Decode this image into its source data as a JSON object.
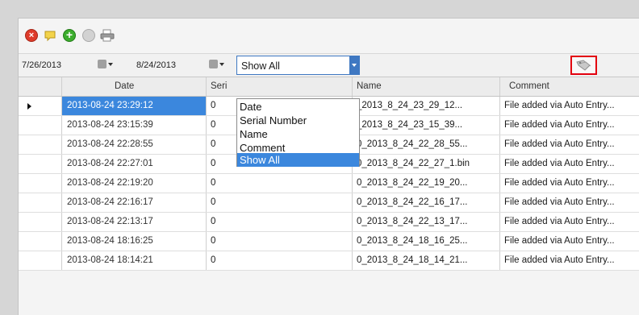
{
  "toolbar": {
    "icons": [
      "delete-icon",
      "note-icon",
      "add-icon",
      "disabled-icon",
      "print-icon"
    ]
  },
  "filters": {
    "start_date": "7/26/2013",
    "end_date": "8/24/2013",
    "combo_value": "Show All",
    "options": [
      "Date",
      "Serial Number",
      "Name",
      "Comment",
      "Show All"
    ],
    "active_option": "Show All"
  },
  "grid": {
    "columns": [
      "",
      "Date",
      "Seri",
      "Name",
      "Comment"
    ],
    "rows": [
      {
        "date": "2013-08-24 23:29:12",
        "serial": "0",
        "name": "_2013_8_24_23_29_12...",
        "comment": "File added via Auto Entry..."
      },
      {
        "date": "2013-08-24 23:15:39",
        "serial": "0",
        "name": "_2013_8_24_23_15_39...",
        "comment": "File added via Auto Entry..."
      },
      {
        "date": "2013-08-24 22:28:55",
        "serial": "0",
        "name": "0_2013_8_24_22_28_55...",
        "comment": "File added via Auto Entry..."
      },
      {
        "date": "2013-08-24 22:27:01",
        "serial": "0",
        "name": "0_2013_8_24_22_27_1.bin",
        "comment": "File added via Auto Entry..."
      },
      {
        "date": "2013-08-24 22:19:20",
        "serial": "0",
        "name": "0_2013_8_24_22_19_20...",
        "comment": "File added via Auto Entry..."
      },
      {
        "date": "2013-08-24 22:16:17",
        "serial": "0",
        "name": "0_2013_8_24_22_16_17...",
        "comment": "File added via Auto Entry..."
      },
      {
        "date": "2013-08-24 22:13:17",
        "serial": "0",
        "name": "0_2013_8_24_22_13_17...",
        "comment": "File added via Auto Entry..."
      },
      {
        "date": "2013-08-24 18:16:25",
        "serial": "0",
        "name": "0_2013_8_24_18_16_25...",
        "comment": "File added via Auto Entry..."
      },
      {
        "date": "2013-08-24 18:14:21",
        "serial": "0",
        "name": "0_2013_8_24_18_14_21...",
        "comment": "File added via Auto Entry..."
      }
    ]
  },
  "colors": {
    "selection": "#3b87dd",
    "highlight_border": "#e3000f"
  }
}
